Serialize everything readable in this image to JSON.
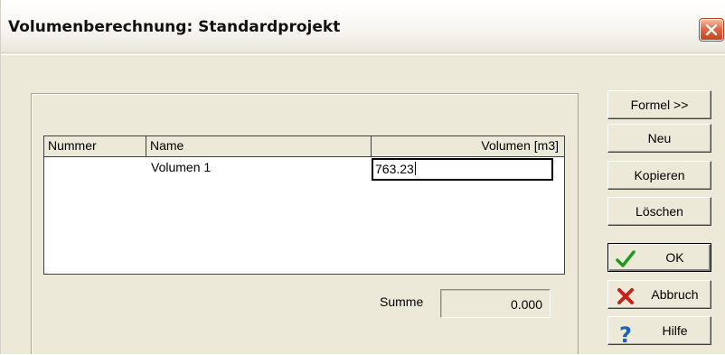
{
  "window": {
    "title": "Volumenberechnung: Standardprojekt"
  },
  "grid": {
    "columns": [
      "Nummer",
      "Name",
      "Volumen [m3]"
    ],
    "rows": [
      {
        "nummer": "",
        "name": "Volumen 1",
        "volumen": "763.23"
      }
    ]
  },
  "summary": {
    "label": "Summe",
    "value": "0.000"
  },
  "buttons": {
    "formel": "Formel >>",
    "neu": "Neu",
    "kopieren": "Kopieren",
    "loeschen": "Löschen",
    "ok": "OK",
    "abbruch": "Abbruch",
    "hilfe": "Hilfe"
  },
  "icons": {
    "close": "close-icon",
    "ok": "checkmark-icon",
    "abbruch": "cross-icon",
    "hilfe": "question-mark-icon"
  },
  "colors": {
    "dialog_background": "#ece9d8",
    "close_button": "#d9582e",
    "ok_check": "#1f9a1f",
    "cancel_cross": "#c8201a",
    "help_question": "#1e5fc2"
  }
}
